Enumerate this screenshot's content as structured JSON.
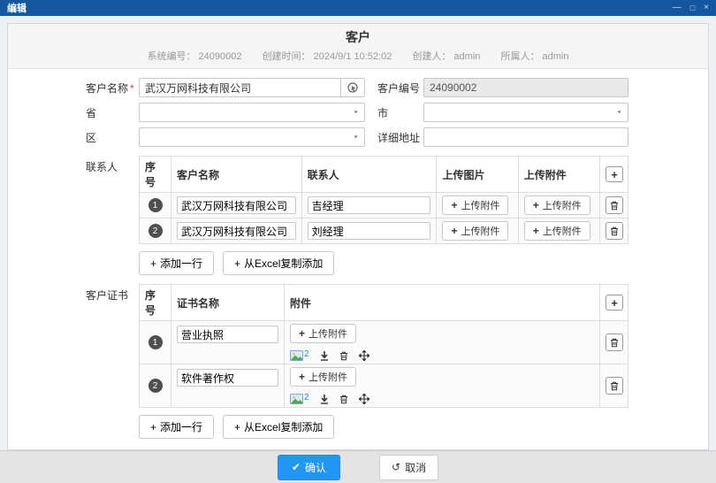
{
  "window": {
    "title": "编辑",
    "controls": {
      "minimize": "—",
      "maximize": "□",
      "close": "×"
    }
  },
  "header": {
    "title": "客户",
    "meta": [
      "系统编号： 24090002",
      "创建时间： 2024/9/1 10:52:02",
      "创建人： admin",
      "所属人： admin"
    ]
  },
  "form": {
    "customer_name": {
      "label": "客户名称",
      "required": "*",
      "value": "武汉万网科技有限公司"
    },
    "customer_code": {
      "label": "客户编号",
      "value": "24090002"
    },
    "province": {
      "label": "省",
      "value": ""
    },
    "city": {
      "label": "市",
      "value": ""
    },
    "district": {
      "label": "区",
      "value": ""
    },
    "address": {
      "label": "详细地址",
      "value": ""
    }
  },
  "contacts": {
    "label": "联系人",
    "columns": {
      "no": "序号",
      "customer": "客户名称",
      "contact": "联系人",
      "image": "上传图片",
      "attachment": "上传附件"
    },
    "upload_button": "上传附件",
    "rows": [
      {
        "no": "1",
        "customer": "武汉万网科技有限公司",
        "contact": "吉经理"
      },
      {
        "no": "2",
        "customer": "武汉万网科技有限公司",
        "contact": "刘经理"
      }
    ],
    "add_row": "添加一行",
    "add_from_excel": "从Excel复制添加"
  },
  "certificates": {
    "label": "客户证书",
    "columns": {
      "no": "序号",
      "name": "证书名称",
      "attachment": "附件"
    },
    "upload_button": "上传附件",
    "rows": [
      {
        "no": "1",
        "name": "营业执照",
        "count": "2"
      },
      {
        "no": "2",
        "name": "软件著作权",
        "count": "2"
      }
    ],
    "add_row": "添加一行",
    "add_from_excel": "从Excel复制添加"
  },
  "footer": {
    "confirm": "确认",
    "cancel": "取消"
  },
  "icons": {
    "plus": "+",
    "check": "✔",
    "undo": "↺",
    "caret": "▼"
  },
  "colors": {
    "titlebar": "#15579e",
    "confirm": "#2196f3",
    "link": "#1e88e5",
    "required": "#e53935"
  }
}
